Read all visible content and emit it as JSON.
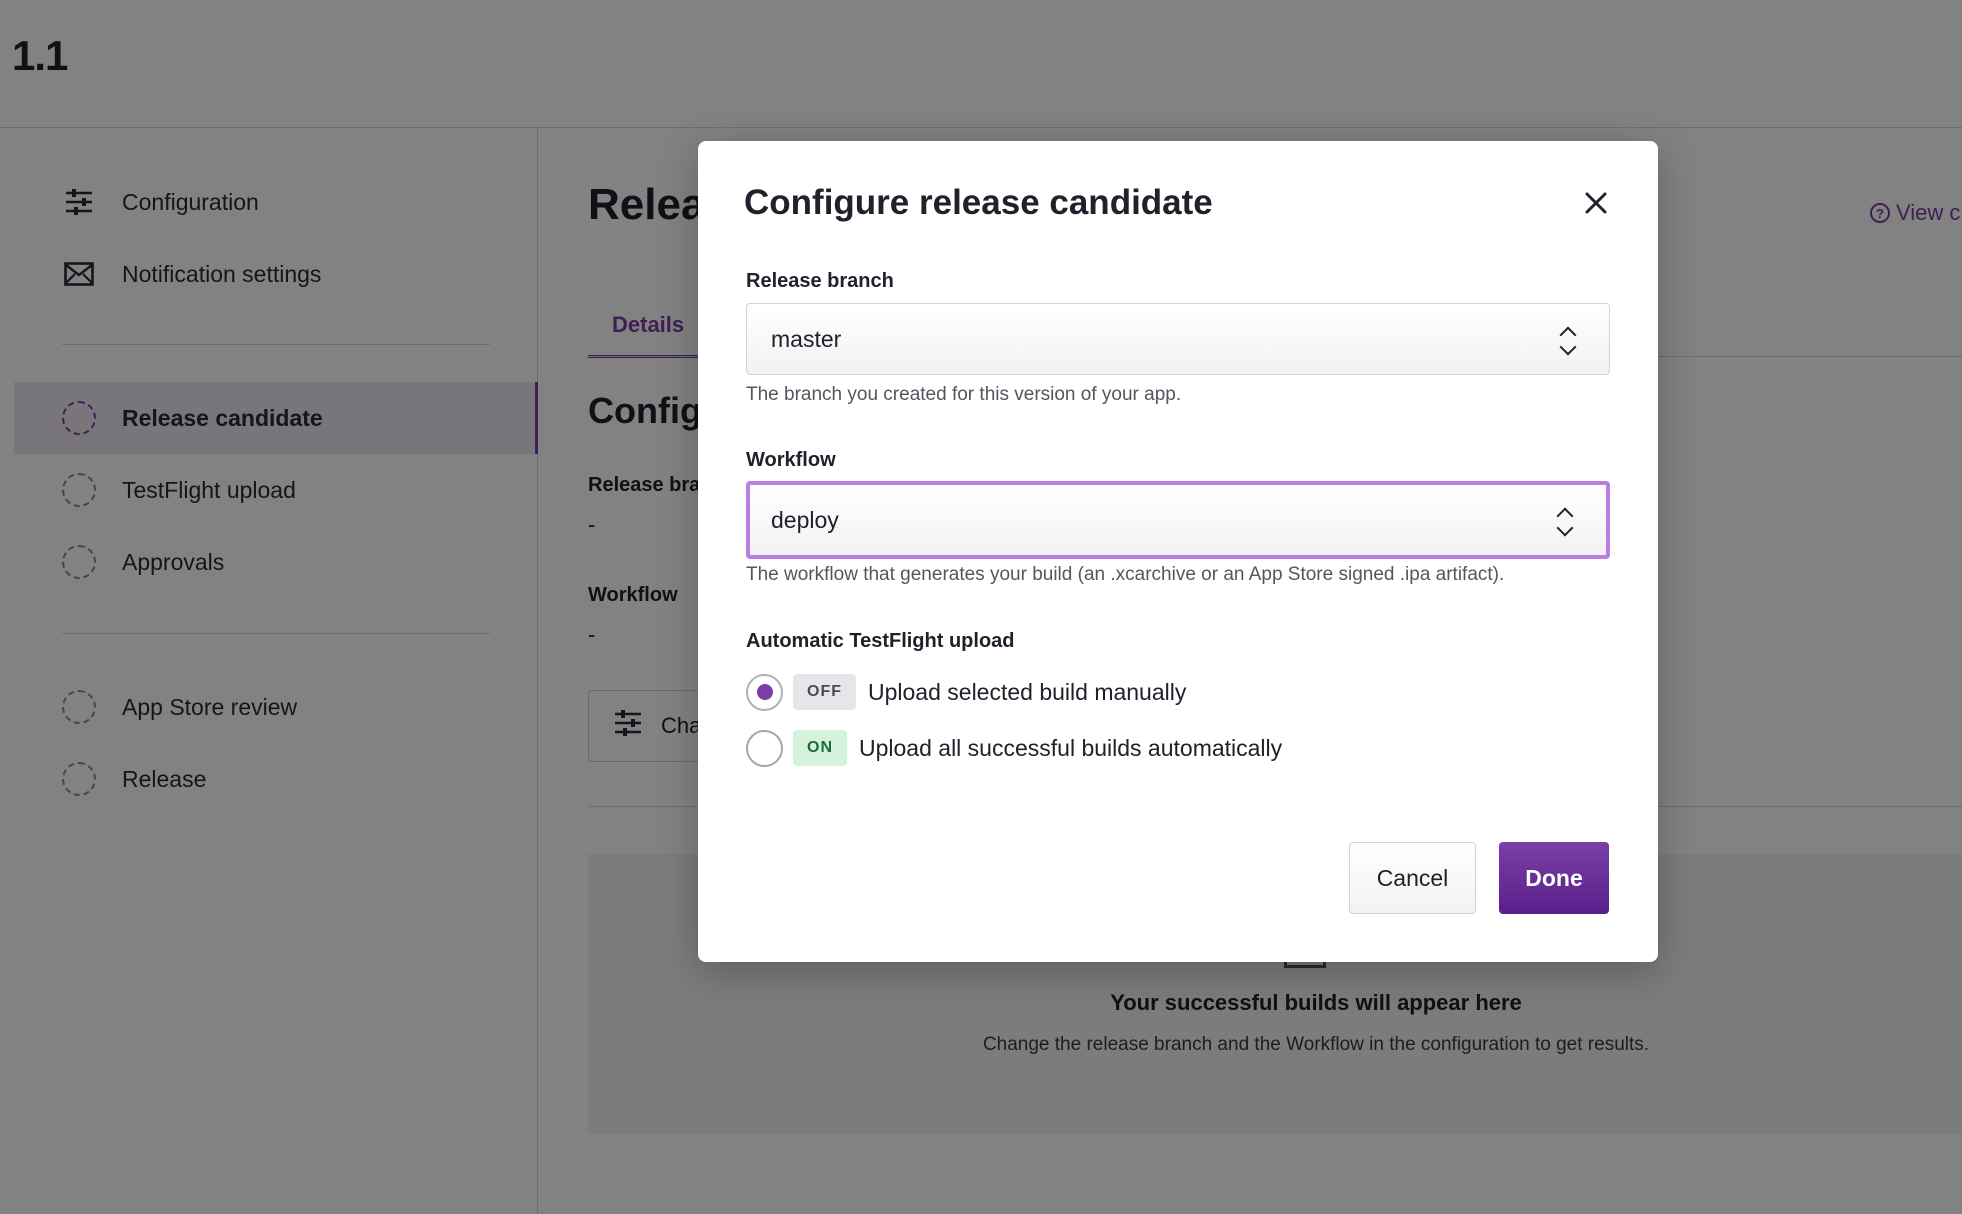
{
  "header": {
    "version": "1.1"
  },
  "sidebar": {
    "top_items": [
      {
        "label": "Configuration",
        "icon": "sliders-icon"
      },
      {
        "label": "Notification settings",
        "icon": "envelope-icon"
      }
    ],
    "steps": [
      {
        "label": "Release candidate",
        "active": true
      },
      {
        "label": "TestFlight upload",
        "active": false
      },
      {
        "label": "Approvals",
        "active": false
      }
    ],
    "later_steps": [
      {
        "label": "App Store review"
      },
      {
        "label": "Release"
      }
    ]
  },
  "main": {
    "title": "Relea",
    "view_link": "View c",
    "tab_details": "Details",
    "section_title": "Config",
    "release_branch_label": "Release bra",
    "release_branch_value": "-",
    "workflow_label": "Workflow",
    "workflow_value": "-",
    "change_button": "Cha",
    "empty_title": "Your successful builds will appear here",
    "empty_subtitle": "Change the release branch and the Workflow in the configuration to get results."
  },
  "modal": {
    "title": "Configure release candidate",
    "release_branch": {
      "label": "Release branch",
      "value": "master",
      "help": "The branch you created for this version of your app."
    },
    "workflow": {
      "label": "Workflow",
      "value": "deploy",
      "help": "The workflow that generates your build (an .xcarchive or an App Store signed .ipa artifact)."
    },
    "testflight": {
      "label": "Automatic TestFlight upload",
      "options": [
        {
          "pill": "OFF",
          "label": "Upload selected build manually",
          "selected": true
        },
        {
          "pill": "ON",
          "label": "Upload all successful builds automatically",
          "selected": false
        }
      ]
    },
    "cancel_label": "Cancel",
    "done_label": "Done"
  },
  "colors": {
    "accent": "#7a3fa8",
    "focus_ring": "#b87fe0",
    "on_pill_bg": "#d4f2dc",
    "off_pill_bg": "#e6e6ea"
  }
}
